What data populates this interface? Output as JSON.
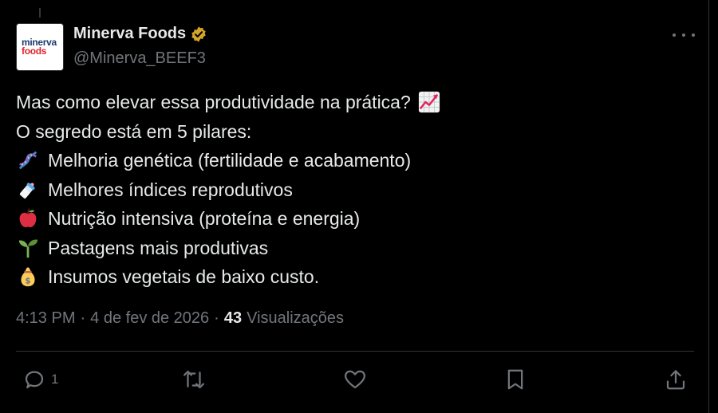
{
  "account": {
    "avatar_line1": "minerva",
    "avatar_line2": "foods",
    "name": "Minerva Foods",
    "handle": "@Minerva_BEEF3",
    "verified_icon": "verified-badge-icon",
    "verified_color": "#d4a52b"
  },
  "tweet": {
    "lines": [
      {
        "text": "Mas como elevar essa produtividade na prática?",
        "emoji": "chart-increasing-icon"
      },
      {
        "text": "O segredo está em 5 pilares:"
      },
      {
        "text": "Melhoria genética (fertilidade e acabamento)",
        "emoji": "dna-icon"
      },
      {
        "text": "Melhores índices reprodutivos",
        "emoji": "baby-bottle-icon"
      },
      {
        "text": "Nutrição intensiva (proteína e energia)",
        "emoji": "red-apple-icon"
      },
      {
        "text": "Pastagens mais produtivas",
        "emoji": "seedling-icon"
      },
      {
        "text": "Insumos vegetais de baixo custo.",
        "emoji": "money-bag-icon"
      }
    ]
  },
  "meta": {
    "time": "4:13 PM",
    "separator": "·",
    "date": "4 de fev de 2026",
    "views_count": "43",
    "views_label": "Visualizações"
  },
  "actions": {
    "reply_icon": "reply-icon",
    "reply_count": "1",
    "retweet_icon": "retweet-icon",
    "like_icon": "heart-icon",
    "bookmark_icon": "bookmark-icon",
    "share_icon": "share-icon"
  },
  "colors": {
    "background": "#000000",
    "text": "#e7e9ea",
    "muted": "#71767b",
    "divider": "#2f3336"
  }
}
